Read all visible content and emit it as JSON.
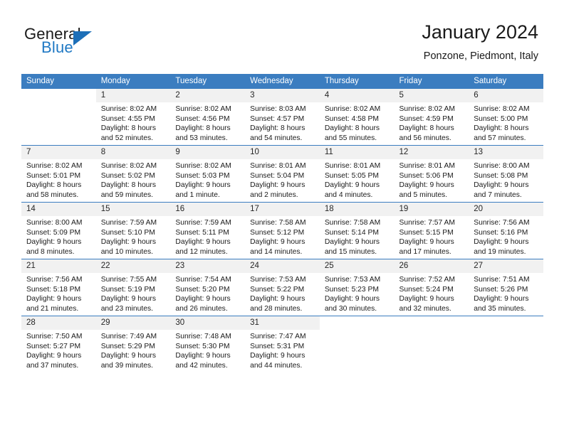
{
  "brand": {
    "name_part1": "General",
    "name_part2": "Blue",
    "logo_icon": "triangle-icon",
    "accent_color": "#2079c4"
  },
  "header": {
    "title": "January 2024",
    "subtitle": "Ponzone, Piedmont, Italy"
  },
  "theme": {
    "header_blue": "#3b7dc0",
    "daynum_gray": "#f1f1f1"
  },
  "calendar": {
    "weekday_headers": [
      "Sunday",
      "Monday",
      "Tuesday",
      "Wednesday",
      "Thursday",
      "Friday",
      "Saturday"
    ],
    "weeks": [
      [
        {
          "day": "",
          "blank": true,
          "lines": []
        },
        {
          "day": "1",
          "lines": [
            "Sunrise: 8:02 AM",
            "Sunset: 4:55 PM",
            "Daylight: 8 hours",
            "and 52 minutes."
          ]
        },
        {
          "day": "2",
          "lines": [
            "Sunrise: 8:02 AM",
            "Sunset: 4:56 PM",
            "Daylight: 8 hours",
            "and 53 minutes."
          ]
        },
        {
          "day": "3",
          "lines": [
            "Sunrise: 8:03 AM",
            "Sunset: 4:57 PM",
            "Daylight: 8 hours",
            "and 54 minutes."
          ]
        },
        {
          "day": "4",
          "lines": [
            "Sunrise: 8:02 AM",
            "Sunset: 4:58 PM",
            "Daylight: 8 hours",
            "and 55 minutes."
          ]
        },
        {
          "day": "5",
          "lines": [
            "Sunrise: 8:02 AM",
            "Sunset: 4:59 PM",
            "Daylight: 8 hours",
            "and 56 minutes."
          ]
        },
        {
          "day": "6",
          "lines": [
            "Sunrise: 8:02 AM",
            "Sunset: 5:00 PM",
            "Daylight: 8 hours",
            "and 57 minutes."
          ]
        }
      ],
      [
        {
          "day": "7",
          "lines": [
            "Sunrise: 8:02 AM",
            "Sunset: 5:01 PM",
            "Daylight: 8 hours",
            "and 58 minutes."
          ]
        },
        {
          "day": "8",
          "lines": [
            "Sunrise: 8:02 AM",
            "Sunset: 5:02 PM",
            "Daylight: 8 hours",
            "and 59 minutes."
          ]
        },
        {
          "day": "9",
          "lines": [
            "Sunrise: 8:02 AM",
            "Sunset: 5:03 PM",
            "Daylight: 9 hours",
            "and 1 minute."
          ]
        },
        {
          "day": "10",
          "lines": [
            "Sunrise: 8:01 AM",
            "Sunset: 5:04 PM",
            "Daylight: 9 hours",
            "and 2 minutes."
          ]
        },
        {
          "day": "11",
          "lines": [
            "Sunrise: 8:01 AM",
            "Sunset: 5:05 PM",
            "Daylight: 9 hours",
            "and 4 minutes."
          ]
        },
        {
          "day": "12",
          "lines": [
            "Sunrise: 8:01 AM",
            "Sunset: 5:06 PM",
            "Daylight: 9 hours",
            "and 5 minutes."
          ]
        },
        {
          "day": "13",
          "lines": [
            "Sunrise: 8:00 AM",
            "Sunset: 5:08 PM",
            "Daylight: 9 hours",
            "and 7 minutes."
          ]
        }
      ],
      [
        {
          "day": "14",
          "lines": [
            "Sunrise: 8:00 AM",
            "Sunset: 5:09 PM",
            "Daylight: 9 hours",
            "and 8 minutes."
          ]
        },
        {
          "day": "15",
          "lines": [
            "Sunrise: 7:59 AM",
            "Sunset: 5:10 PM",
            "Daylight: 9 hours",
            "and 10 minutes."
          ]
        },
        {
          "day": "16",
          "lines": [
            "Sunrise: 7:59 AM",
            "Sunset: 5:11 PM",
            "Daylight: 9 hours",
            "and 12 minutes."
          ]
        },
        {
          "day": "17",
          "lines": [
            "Sunrise: 7:58 AM",
            "Sunset: 5:12 PM",
            "Daylight: 9 hours",
            "and 14 minutes."
          ]
        },
        {
          "day": "18",
          "lines": [
            "Sunrise: 7:58 AM",
            "Sunset: 5:14 PM",
            "Daylight: 9 hours",
            "and 15 minutes."
          ]
        },
        {
          "day": "19",
          "lines": [
            "Sunrise: 7:57 AM",
            "Sunset: 5:15 PM",
            "Daylight: 9 hours",
            "and 17 minutes."
          ]
        },
        {
          "day": "20",
          "lines": [
            "Sunrise: 7:56 AM",
            "Sunset: 5:16 PM",
            "Daylight: 9 hours",
            "and 19 minutes."
          ]
        }
      ],
      [
        {
          "day": "21",
          "lines": [
            "Sunrise: 7:56 AM",
            "Sunset: 5:18 PM",
            "Daylight: 9 hours",
            "and 21 minutes."
          ]
        },
        {
          "day": "22",
          "lines": [
            "Sunrise: 7:55 AM",
            "Sunset: 5:19 PM",
            "Daylight: 9 hours",
            "and 23 minutes."
          ]
        },
        {
          "day": "23",
          "lines": [
            "Sunrise: 7:54 AM",
            "Sunset: 5:20 PM",
            "Daylight: 9 hours",
            "and 26 minutes."
          ]
        },
        {
          "day": "24",
          "lines": [
            "Sunrise: 7:53 AM",
            "Sunset: 5:22 PM",
            "Daylight: 9 hours",
            "and 28 minutes."
          ]
        },
        {
          "day": "25",
          "lines": [
            "Sunrise: 7:53 AM",
            "Sunset: 5:23 PM",
            "Daylight: 9 hours",
            "and 30 minutes."
          ]
        },
        {
          "day": "26",
          "lines": [
            "Sunrise: 7:52 AM",
            "Sunset: 5:24 PM",
            "Daylight: 9 hours",
            "and 32 minutes."
          ]
        },
        {
          "day": "27",
          "lines": [
            "Sunrise: 7:51 AM",
            "Sunset: 5:26 PM",
            "Daylight: 9 hours",
            "and 35 minutes."
          ]
        }
      ],
      [
        {
          "day": "28",
          "lines": [
            "Sunrise: 7:50 AM",
            "Sunset: 5:27 PM",
            "Daylight: 9 hours",
            "and 37 minutes."
          ]
        },
        {
          "day": "29",
          "lines": [
            "Sunrise: 7:49 AM",
            "Sunset: 5:29 PM",
            "Daylight: 9 hours",
            "and 39 minutes."
          ]
        },
        {
          "day": "30",
          "lines": [
            "Sunrise: 7:48 AM",
            "Sunset: 5:30 PM",
            "Daylight: 9 hours",
            "and 42 minutes."
          ]
        },
        {
          "day": "31",
          "lines": [
            "Sunrise: 7:47 AM",
            "Sunset: 5:31 PM",
            "Daylight: 9 hours",
            "and 44 minutes."
          ]
        },
        {
          "day": "",
          "blank": true,
          "lines": []
        },
        {
          "day": "",
          "blank": true,
          "lines": []
        },
        {
          "day": "",
          "blank": true,
          "lines": []
        }
      ]
    ]
  }
}
